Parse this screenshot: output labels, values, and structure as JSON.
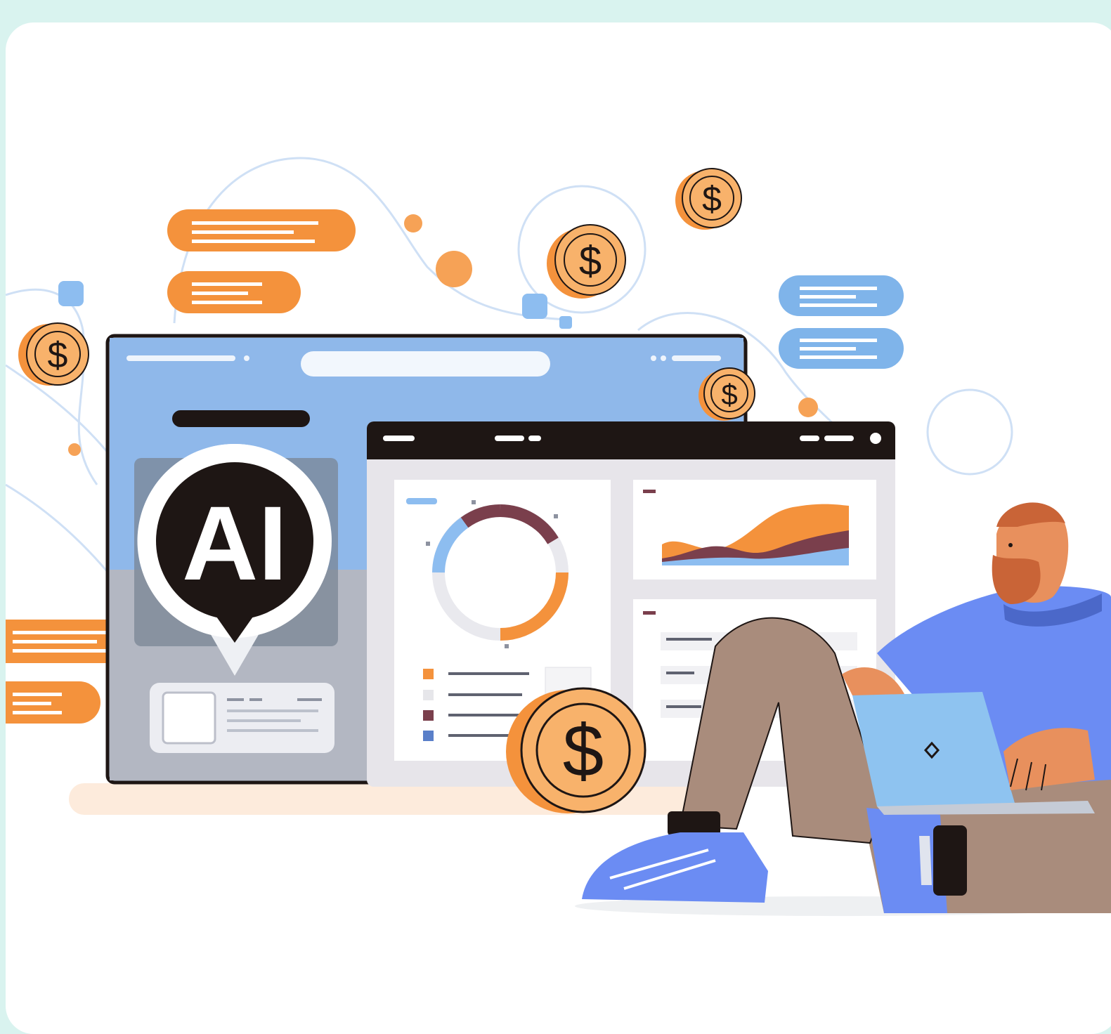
{
  "illustration": {
    "badge_text": "AI",
    "coin_symbol": "$",
    "colors": {
      "background": "#d9f3ef",
      "card": "#ffffff",
      "orange": "#f4923c",
      "blue": "#7fb4ea",
      "dark": "#1e1614",
      "maroon": "#7a3f4c",
      "shirt": "#6b8cf3",
      "pants": "#a98c7c",
      "skin": "#e8905d",
      "hair": "#c96437"
    },
    "icons": [
      "ai-badge-icon",
      "dollar-coin-icon",
      "laptop-icon",
      "donut-chart-icon",
      "area-chart-icon"
    ]
  }
}
